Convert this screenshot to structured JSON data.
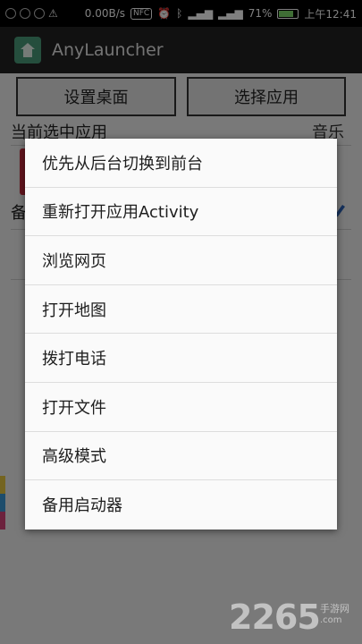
{
  "status_bar": {
    "net_speed": "0.00B/s",
    "nfc": "NFC",
    "battery_percent": "71%",
    "time": "上午12:41"
  },
  "app_bar": {
    "title": "AnyLauncher"
  },
  "main": {
    "set_desktop_button": "设置桌面",
    "choose_app_button": "选择应用",
    "current_app_label": "当前选中应用",
    "current_app_value": "音乐",
    "backup_label": "备"
  },
  "menu": {
    "items": [
      "优先从后台切换到前台",
      "重新打开应用Activity",
      "浏览网页",
      "打开地图",
      "拨打电话",
      "打开文件",
      "高级模式",
      "备用启动器"
    ]
  },
  "watermark": {
    "brand": "2265",
    "sub": "手游网",
    "url": ".com"
  }
}
